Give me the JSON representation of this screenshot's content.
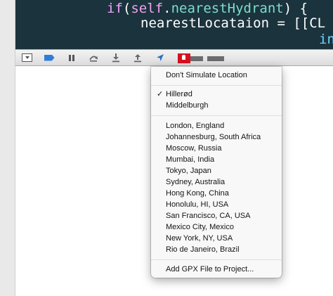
{
  "editor": {
    "line1": {
      "kw": "if",
      "open": "(",
      "self": "self",
      "dot": ".",
      "ident": "nearestHydrant",
      "close": ") {"
    },
    "line2": {
      "ident": "nearestLocataion",
      "rest": " = [[CL"
    },
    "line3": {
      "text": "in"
    }
  },
  "debugbar": {
    "icons": [
      "hide-console-icon",
      "breakpoints-toggle-icon",
      "pause-icon",
      "step-over-icon",
      "step-in-icon",
      "step-out-icon",
      "simulate-location-icon"
    ]
  },
  "location_menu": {
    "dont_simulate": "Don't Simulate Location",
    "custom": [
      {
        "label": "Hillerød",
        "checked": true
      },
      {
        "label": "Middelburgh",
        "checked": false
      }
    ],
    "check_glyph": "✓",
    "presets": [
      "London, England",
      "Johannesburg, South Africa",
      "Moscow, Russia",
      "Mumbai, India",
      "Tokyo, Japan",
      "Sydney, Australia",
      "Hong Kong, China",
      "Honolulu, HI, USA",
      "San Francisco, CA, USA",
      "Mexico City, Mexico",
      "New York, NY, USA",
      "Rio de Janeiro, Brazil"
    ],
    "add_gpx": "Add GPX File to Project..."
  },
  "colors": {
    "editor_bg": "#1b333d",
    "keyword": "#f2a2ff",
    "identifier": "#7dddc8",
    "accent_red": "#d8111f",
    "breakpoint_blue": "#2f7dd8"
  }
}
